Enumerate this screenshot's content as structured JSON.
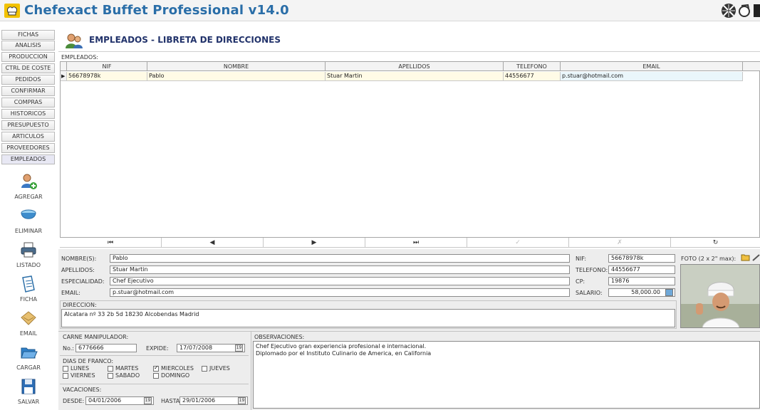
{
  "app": {
    "title": "Chefexact Buffet Professional v14.0"
  },
  "sidebar": {
    "items": [
      {
        "label": "FICHAS"
      },
      {
        "label": "ANALISIS"
      },
      {
        "label": "PRODUCCION"
      },
      {
        "label": "CTRL DE COSTE"
      },
      {
        "label": "PEDIDOS"
      },
      {
        "label": "CONFIRMAR"
      },
      {
        "label": "COMPRAS"
      },
      {
        "label": "HISTORICOS"
      },
      {
        "label": "PRESUPUESTO"
      },
      {
        "label": "ARTICULOS"
      },
      {
        "label": "PROVEEDORES"
      },
      {
        "label": "EMPLEADOS"
      }
    ],
    "tools": [
      {
        "label": "AGREGAR",
        "icon": "add-user-icon"
      },
      {
        "label": "ELIMINAR",
        "icon": "bowl-icon"
      },
      {
        "label": "LISTADO",
        "icon": "printer-icon"
      },
      {
        "label": "FICHA",
        "icon": "document-icon"
      },
      {
        "label": "EMAIL",
        "icon": "envelope-icon"
      },
      {
        "label": "CARGAR",
        "icon": "folder-open-icon"
      },
      {
        "label": "SALVAR",
        "icon": "save-icon"
      }
    ]
  },
  "header": {
    "title": "EMPLEADOS - LIBRETA DE DIRECCIONES"
  },
  "grid": {
    "label": "EMPLEADOS:",
    "columns": [
      "NIF",
      "NOMBRE",
      "APELLIDOS",
      "TELEFONO",
      "EMAIL"
    ],
    "rows": [
      [
        "56678978k",
        "Pablo",
        "Stuar Martin",
        "44556677",
        "p.stuar@hotmail.com"
      ]
    ]
  },
  "navigator": {
    "first": "⏮",
    "prior": "◀",
    "next": "▶",
    "last": "⏭",
    "post": "✓",
    "cancel": "✗",
    "refresh": "↻"
  },
  "form": {
    "nombre_label": "NOMBRE(S):",
    "nombre": "Pablo",
    "apellidos_label": "APELLIDOS:",
    "apellidos": "Stuar Martin",
    "especialidad_label": "ESPECIALIDAD:",
    "especialidad": "Chef Ejecutivo",
    "email_label": "EMAIL:",
    "email": "p.stuar@hotmail.com",
    "nif_label": "NIF:",
    "nif": "56678978k",
    "telefono_label": "TELEFONO:",
    "telefono": "44556677",
    "cp_label": "CP:",
    "cp": "19876",
    "salario_label": "SALARIO:",
    "salario": "58,000.00",
    "foto_label": "FOTO (2 x 2\" max):",
    "direccion_label": "DIRECCION:",
    "direccion": "Alcatara nº 33 2b 5d  18230 Alcobendas Madrid",
    "carne_label": "CARNE MANIPULADOR:",
    "no_label": "No.:",
    "no": "6776666",
    "expide_label": "EXPIDE:",
    "expide": "17/07/2008",
    "dias_label": "DIAS DE FRANCO:",
    "dias": [
      {
        "label": "LUNES",
        "checked": false
      },
      {
        "label": "MARTES",
        "checked": false
      },
      {
        "label": "MIERCOLES",
        "checked": true
      },
      {
        "label": "JUEVES",
        "checked": false
      },
      {
        "label": "VIERNES",
        "checked": false
      },
      {
        "label": "SABADO",
        "checked": false
      },
      {
        "label": "DOMINGO",
        "checked": false
      }
    ],
    "vacaciones_label": "VACACIONES:",
    "desde_label": "DESDE:",
    "desde": "04/01/2006",
    "hasta_label": "HASTA:",
    "hasta": "29/01/2006",
    "observaciones_label": "OBSERVACIONES:",
    "observaciones_1": "Chef Ejecutivo gran experiencia profesional e internacional.",
    "observaciones_2": "Diplomado por el Instituto Culinario de America, en California",
    "cal_glyph": "19"
  }
}
